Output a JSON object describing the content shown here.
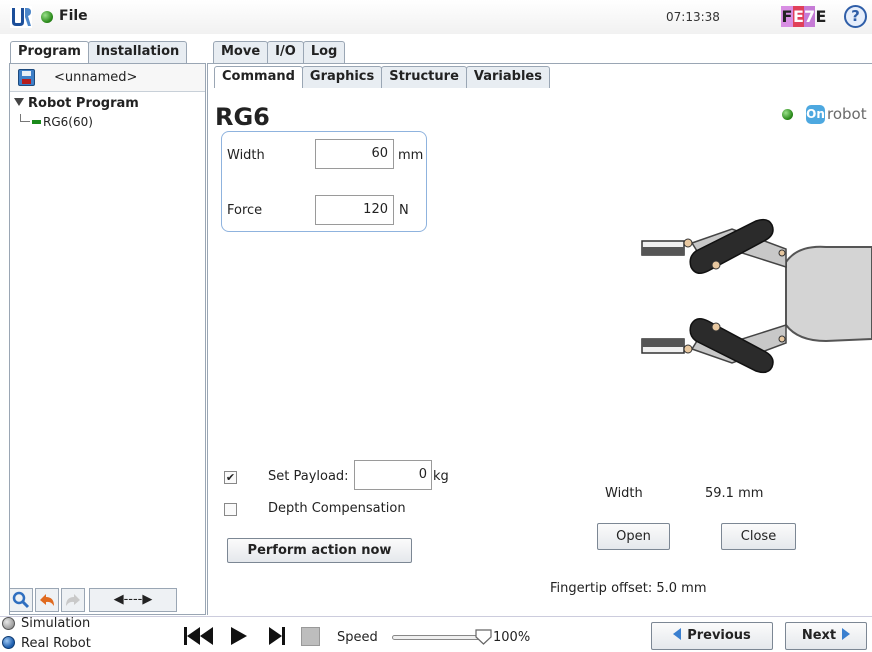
{
  "header": {
    "menu_label": "File",
    "clock": "07:13:38",
    "status_code": [
      "F",
      "E",
      "7",
      "E"
    ],
    "help_symbol": "?"
  },
  "left_tabs": [
    "Program",
    "Installation"
  ],
  "top_tabs": [
    "Move",
    "I/O",
    "Log"
  ],
  "sub_tabs": [
    "Command",
    "Graphics",
    "Structure",
    "Variables"
  ],
  "program": {
    "name": "<unnamed>",
    "tree_root": "Robot Program",
    "tree_child": "RG6(60)"
  },
  "tool_nav_label": "◀----▶",
  "node": {
    "title": "RG6",
    "brand_text": "robot",
    "brand_icon": "On",
    "width_label": "Width",
    "width_value": "60",
    "width_unit": "mm",
    "force_label": "Force",
    "force_value": "120",
    "force_unit": "N",
    "set_payload_label": "Set Payload:",
    "set_payload_checked": true,
    "payload_value": "0",
    "payload_unit": "kg",
    "depth_comp_label": "Depth Compensation",
    "depth_comp_checked": false,
    "perform_button": "Perform action now",
    "status_width_label": "Width",
    "status_width_value": "59.1 mm",
    "open_button": "Open",
    "close_button": "Close",
    "fingertip_offset": "Fingertip offset: 5.0 mm"
  },
  "footer": {
    "simulation_label": "Simulation",
    "real_robot_label": "Real Robot",
    "speed_label": "Speed",
    "speed_value": "100%",
    "speed_fraction": 1.0,
    "previous_button": "Previous",
    "next_button": "Next"
  },
  "colors": {
    "accent": "#3a7fcf",
    "status_green": "#2a8a1a",
    "code_F_bg": "#d88ee3",
    "code_E_bg": "#e0405a",
    "code_7_bg": "#c67bd6",
    "onrobot_blue": "#4da8e0"
  },
  "icons": {
    "logo": "ur-logo-icon",
    "status": "green-status-icon",
    "help": "help-icon",
    "save": "disk-icon",
    "search": "magnifier-icon",
    "undo": "undo-icon",
    "redo": "redo-icon"
  }
}
